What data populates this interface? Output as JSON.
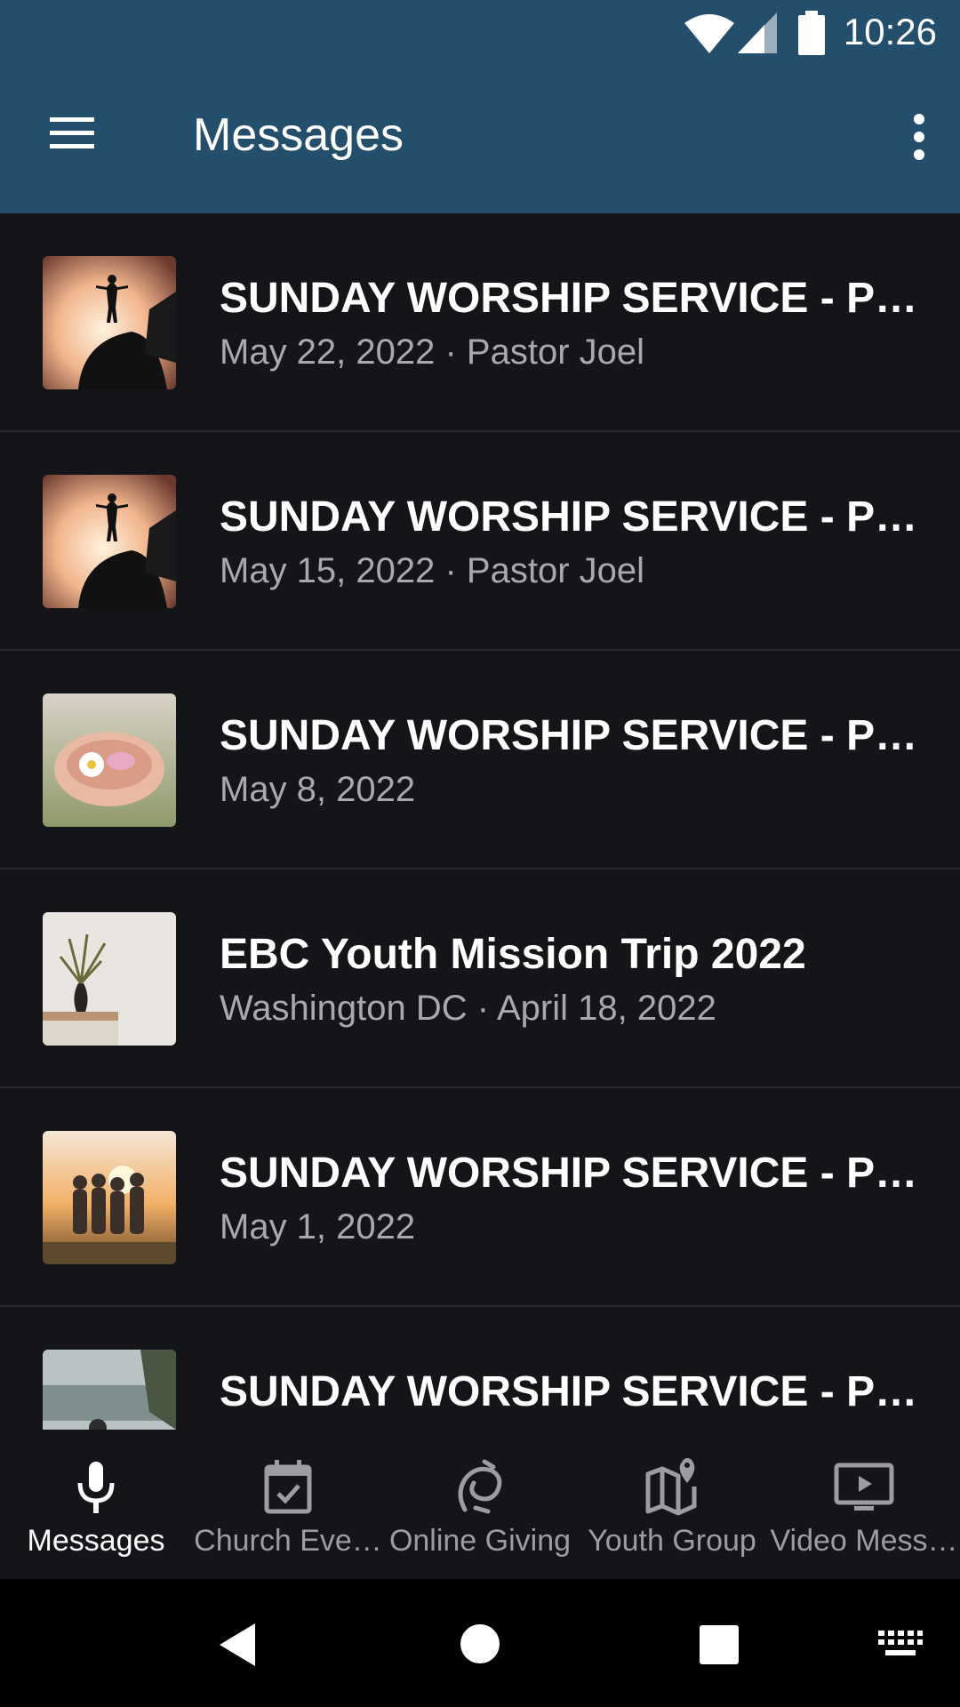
{
  "status": {
    "time": "10:26"
  },
  "header": {
    "title": "Messages"
  },
  "messages": [
    {
      "title": "SUNDAY WORSHIP SERVICE - Pa…",
      "subtitle": "May 22, 2022 · Pastor Joel",
      "thumb": "sunset-silhouette"
    },
    {
      "title": "SUNDAY WORSHIP SERVICE - Pa…",
      "subtitle": "May 15, 2022 · Pastor Joel",
      "thumb": "sunset-silhouette"
    },
    {
      "title": "SUNDAY WORSHIP SERVICE - Pa…",
      "subtitle": "May 8, 2022",
      "thumb": "hands-flowers"
    },
    {
      "title": "EBC Youth Mission Trip 2022",
      "subtitle": "Washington DC · April 18, 2022",
      "thumb": "vase-plant"
    },
    {
      "title": "SUNDAY WORSHIP SERVICE - Pa…",
      "subtitle": "May 1, 2022",
      "thumb": "friends-sunset"
    },
    {
      "title": "SUNDAY WORSHIP SERVICE - Pa…",
      "subtitle": "",
      "thumb": "lake-view"
    }
  ],
  "bottom_nav": [
    {
      "label": "Messages",
      "icon": "microphone-icon",
      "active": true
    },
    {
      "label": "Church Eve…",
      "icon": "calendar-check-icon",
      "active": false
    },
    {
      "label": "Online Giving",
      "icon": "giving-icon",
      "active": false
    },
    {
      "label": "Youth Group",
      "icon": "map-pin-icon",
      "active": false
    },
    {
      "label": "Video Mess…",
      "icon": "video-icon",
      "active": false
    }
  ],
  "colors": {
    "appbar": "#244f6c",
    "background": "#141518",
    "subtitle": "#a7a9ae",
    "inactive_nav": "#9b9da2"
  }
}
